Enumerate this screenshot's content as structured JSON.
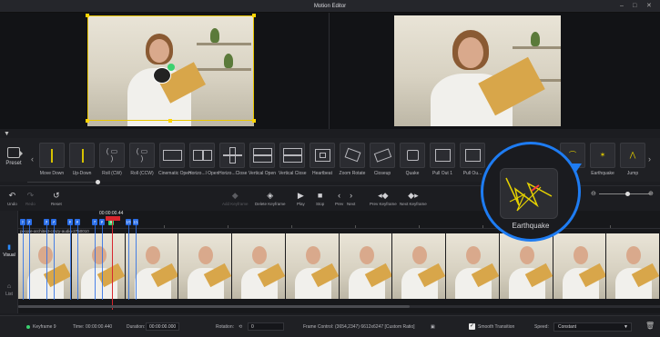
{
  "window": {
    "title": "Motion Editor",
    "minimize": "–",
    "maximize": "□",
    "close": "✕"
  },
  "presets": {
    "section_label": "Preset",
    "items": [
      {
        "name": "Move Down",
        "icon": "move-down-icon"
      },
      {
        "name": "Up-Down",
        "icon": "up-down-icon"
      },
      {
        "name": "Roll (CW)",
        "icon": "roll-cw-icon"
      },
      {
        "name": "Roll (CCW)",
        "icon": "roll-ccw-icon"
      },
      {
        "name": "Cinematic Open",
        "icon": "cinematic-open-icon"
      },
      {
        "name": "Horizo...l Open",
        "icon": "horizontal-open-icon"
      },
      {
        "name": "Horizo...Close",
        "icon": "horizontal-close-icon"
      },
      {
        "name": "Vertical Open",
        "icon": "vertical-open-icon"
      },
      {
        "name": "Vertical Close",
        "icon": "vertical-close-icon"
      },
      {
        "name": "Heartbeat",
        "icon": "heartbeat-icon"
      },
      {
        "name": "Zoom Rotate",
        "icon": "zoom-rotate-icon"
      },
      {
        "name": "Closeup",
        "icon": "closeup-icon"
      },
      {
        "name": "Quake",
        "icon": "quake-icon"
      },
      {
        "name": "Pull Out 1",
        "icon": "pull-out-icon"
      },
      {
        "name": "Pull Ou...",
        "icon": "pull-out-icon"
      },
      {
        "name": "",
        "icon": "preset-icon"
      },
      {
        "name": "",
        "icon": "preset-icon"
      },
      {
        "name": "Earthquake",
        "icon": "earthquake-icon"
      },
      {
        "name": "Jump",
        "icon": "jump-icon"
      }
    ],
    "highlighted": {
      "name": "Earthquake"
    }
  },
  "toolbar": {
    "undo": "Undo",
    "redo": "Redo",
    "reset": "Reset",
    "add_keyframe": "Add Keyframe",
    "delete_keyframe": "Delete Keyframe",
    "play": "Play",
    "stop": "Stop",
    "prev": "Prev",
    "next": "Next",
    "prev_keyframe": "Prev Keyframe",
    "next_keyframe": "Next Keyframe"
  },
  "timeline": {
    "playhead_time": "00:00:00.44",
    "clip_name": "people-architect-crazy-audio-2750010",
    "side_tabs": [
      {
        "label": "Visual",
        "active": true
      },
      {
        "label": "List",
        "active": false
      }
    ],
    "keyframe_markers": [
      "1",
      "2",
      "3",
      "4",
      "5",
      "6",
      "7",
      "8",
      "9",
      "10",
      "11"
    ]
  },
  "status": {
    "keyframe": "Keyframe 9",
    "time_label": "Time:",
    "time_value": "00:00:00.440",
    "duration_label": "Duration:",
    "duration_value": "00:00:00.000",
    "rotation_label": "Rotation:",
    "rotation_value": "0",
    "frame_control_label": "Frame Control:",
    "frame_control_value": "(3654,2347) 6612x6247 [Custom Ratio]",
    "smooth_label": "Smooth Transition",
    "smooth_checked": true,
    "speed_label": "Speed:",
    "speed_value": "Constant"
  },
  "colors": {
    "accent_blue": "#1e7cf2",
    "keyframe_blue": "#2b6fe8",
    "playhead_red": "#d8262e",
    "crop_yellow": "#e8c600"
  }
}
